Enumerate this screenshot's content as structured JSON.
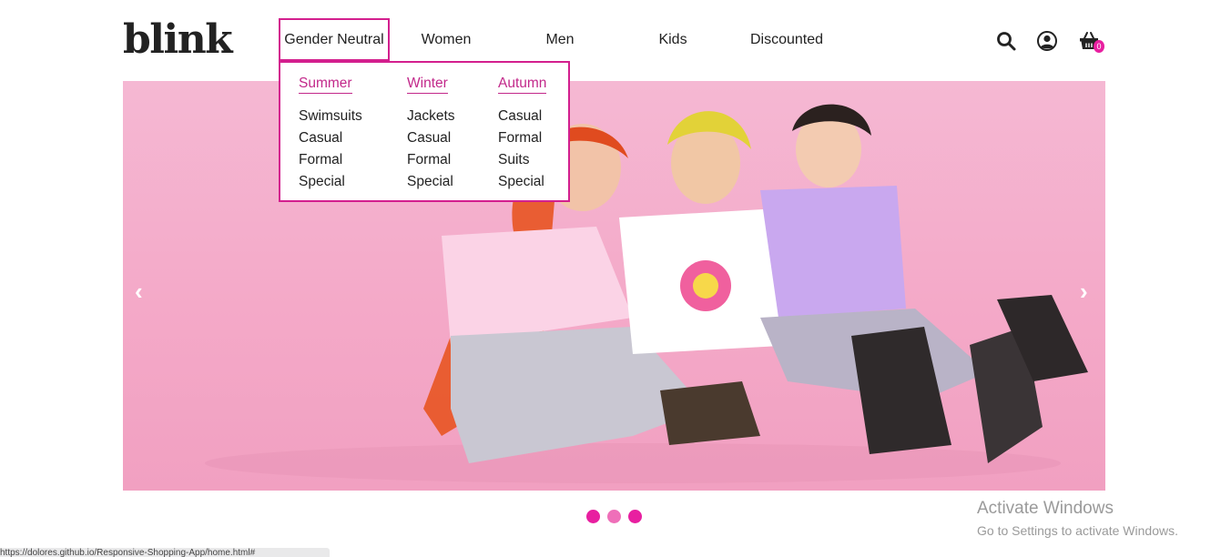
{
  "brand": {
    "logo_text": "blink"
  },
  "nav": {
    "items": [
      {
        "label": "Gender Neutral"
      },
      {
        "label": "Women"
      },
      {
        "label": "Men"
      },
      {
        "label": "Kids"
      },
      {
        "label": "Discounted"
      }
    ],
    "active": "Gender Neutral"
  },
  "header_icons": {
    "search": "search-icon",
    "account": "user-circle-icon",
    "cart": "basket-icon",
    "cart_count": "0"
  },
  "dropdown": {
    "columns": [
      {
        "heading": "Summer",
        "links": [
          "Swimsuits",
          "Casual",
          "Formal",
          "Special"
        ]
      },
      {
        "heading": "Winter",
        "links": [
          "Jackets",
          "Casual",
          "Formal",
          "Special"
        ]
      },
      {
        "heading": "Autumn",
        "links": [
          "Casual",
          "Formal",
          "Suits",
          "Special"
        ]
      }
    ]
  },
  "carousel": {
    "prev": "‹",
    "next": "›",
    "slide_count": 3
  },
  "colors": {
    "accent": "#d31f8e",
    "dot": "#e81fa0",
    "hero_bg": "#f4a9c8"
  },
  "watermark": {
    "title": "Activate Windows",
    "subtitle": "Go to Settings to activate Windows."
  },
  "status_bar": {
    "url": "https://dolores.github.io/Responsive-Shopping-App/home.html#"
  }
}
